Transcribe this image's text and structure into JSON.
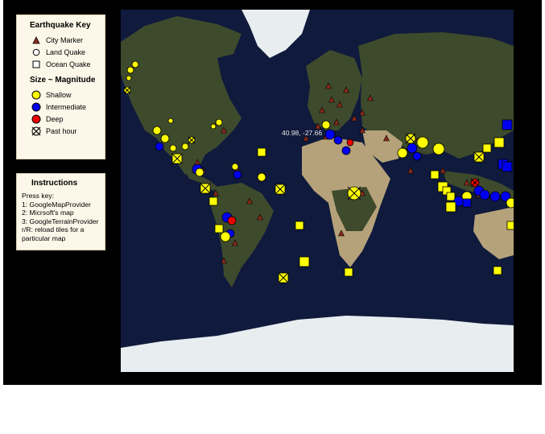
{
  "legend": {
    "title": "Earthquake Key",
    "symbols": [
      {
        "label": "City Marker",
        "icon": "triangle-icon"
      },
      {
        "label": "Land Quake",
        "icon": "circle-icon"
      },
      {
        "label": "Ocean Quake",
        "icon": "square-icon"
      }
    ],
    "size_title": "Size ~ Magnitude",
    "magnitudes": [
      {
        "label": "Shallow",
        "color": "#ffff00"
      },
      {
        "label": "Intermediate",
        "color": "#0000ee"
      },
      {
        "label": "Deep",
        "color": "#ee0000"
      },
      {
        "label": "Past hour",
        "icon": "crossed-circle-icon"
      }
    ]
  },
  "instructions": {
    "title": "Instructions",
    "lines": [
      "Press key:",
      "1: GoogleMapProvider",
      "2: Micrsoft's map",
      "3: GoogleTerrainProvider",
      "r/R: reload tiles for a",
      "particular map"
    ]
  },
  "map": {
    "coordinate_readout": "40.98, -27.66",
    "colors": {
      "ocean": "#0f1a3c",
      "land": "#3e4a2c",
      "desert": "#b5a27a",
      "ice": "#e8edf0",
      "city_marker": "#8b2a1a",
      "shallow": "#ffff00",
      "intermediate": "#0000ee",
      "deep": "#ee0000"
    }
  }
}
